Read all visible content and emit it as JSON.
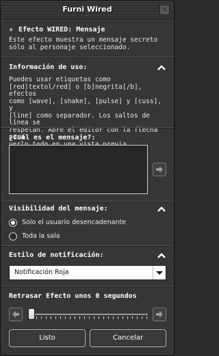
{
  "window": {
    "title": "Furni Wired"
  },
  "effect": {
    "heading": "Efecto WIRED: Mensaje",
    "description_lines": [
      "Este efecto muestra un mensaje secreto",
      "sólo al personaje seleccionado."
    ]
  },
  "usage_info": {
    "heading": "Información de uso:",
    "lines": [
      "Puedes usar etiquetas como",
      "[red]textol/red] o [b]negrita[/b], efectos",
      "como [wave], [shake], [pulse] y [cuss], y",
      "[line] como separador. Los saltos de línea se",
      "respetan. Abre el editor con la flecha para",
      "verlo todo en una vista previa."
    ]
  },
  "message": {
    "heading": "¿Cuál es el mensaje?:",
    "value": ""
  },
  "visibility": {
    "heading": "Visibilidad del mensaje:",
    "options": [
      {
        "label": "Solo el usuario desencadenante",
        "selected": true
      },
      {
        "label": "Toda la sala",
        "selected": false
      }
    ]
  },
  "notification": {
    "heading": "Estilo de notificación:",
    "selected": "Notificación Roja"
  },
  "delay": {
    "heading": "Retrasar Efecto unos 0 segundos",
    "value_seconds": 0
  },
  "buttons": {
    "ok": "Listo",
    "cancel": "Cancelar"
  },
  "colors": {
    "panel": "#363636",
    "text": "#f2f2f2",
    "select_bg": "#ffffff"
  }
}
